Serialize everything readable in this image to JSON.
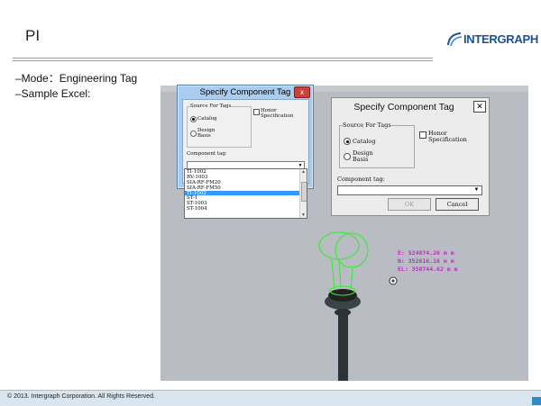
{
  "slide": {
    "title": "PI",
    "logo_text": "INTERGRAPH",
    "bullets": [
      "–Mode：Engineering Tag",
      "–Sample Excel:"
    ],
    "footer": "© 2013. Intergraph Corporation. All Rights Reserved."
  },
  "dialog_left": {
    "title": "Specify Component Tag",
    "close_label": "x",
    "group_label": "Source For Tags",
    "radio_catalog": "Catalog",
    "radio_design_basis": "Design Basis",
    "honor_spec": "Honor Specification",
    "component_tag_label": "Component tag:",
    "combo_value": "",
    "list_items": [
      "TI-1002",
      "BV-1003",
      "SIA-RF-FM20",
      "SIA-RF-FM50",
      "TI-1002",
      "ST-1",
      "ST-1003",
      "ST-1004"
    ],
    "selected_index": 4
  },
  "dialog_right": {
    "title": "Specify Component Tag",
    "close_label": "✕",
    "group_label": "Source For Tags",
    "radio_catalog": "Catalog",
    "radio_design_basis": "Design Basis",
    "honor_spec": "Honor Specification",
    "component_tag_label": "Component tag:",
    "combo_value": "",
    "ok_label": "OK",
    "cancel_label": "Cancel"
  },
  "coordinates": {
    "e": "E: 524874.26 m m",
    "n": "N: 352616.16 m m",
    "el": "EL: 358744.62 m m"
  },
  "colors": {
    "accent_brand": "#16529a",
    "coord_text": "#c02cc6",
    "model_green": "#33ee33",
    "viewport_bg": "#b9bcc2"
  }
}
